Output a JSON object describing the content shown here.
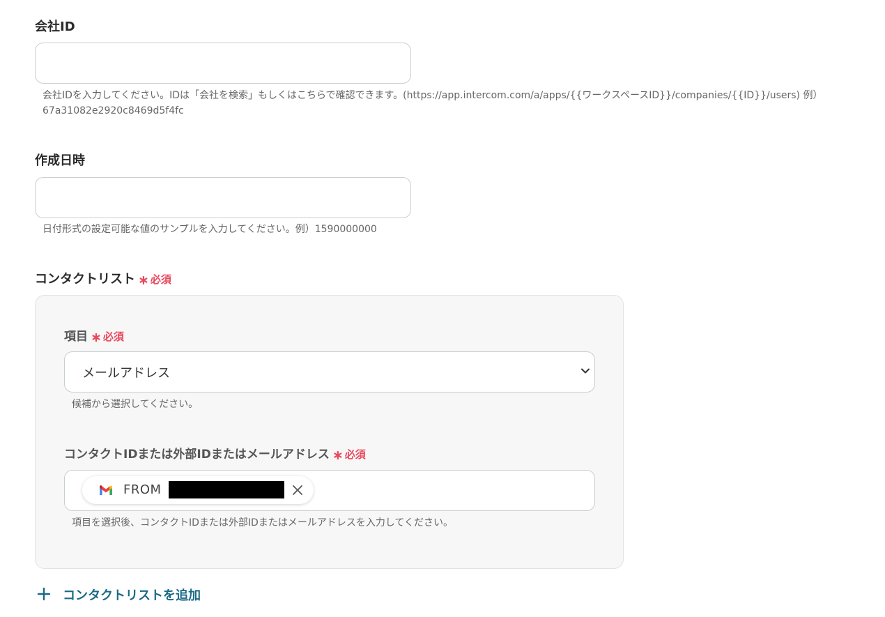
{
  "company_id": {
    "label": "会社ID",
    "value": "",
    "help_line1": "会社IDを入力してください。IDは「会社を検索」もしくはこちらで確認できます。(https://app.intercom.com/a/apps/{{ワークスペースID}}/companies/{{ID}}/users) 例）",
    "help_line2": "67a31082e2920c8469d5f4fc"
  },
  "created_at": {
    "label": "作成日時",
    "value": "",
    "help": "日付形式の設定可能な値のサンプルを入力してください。例）1590000000"
  },
  "contact_list": {
    "label": "コンタクトリスト",
    "required_mark": "∗",
    "required_text": "必須",
    "item": {
      "label": "項目",
      "selected": "メールアドレス",
      "help": "候補から選択してください。"
    },
    "contact": {
      "label": "コンタクトIDまたは外部IDまたはメールアドレス",
      "chip_text": "FROM",
      "chip_icon": "gmail-icon",
      "help": "項目を選択後、コンタクトIDまたは外部IDまたはメールアドレスを入力してください。"
    }
  },
  "add_button": {
    "label": "コンタクトリストを追加",
    "icon": "plus-icon"
  },
  "colors": {
    "required": "#e8485e",
    "accent": "#1b6a86"
  }
}
